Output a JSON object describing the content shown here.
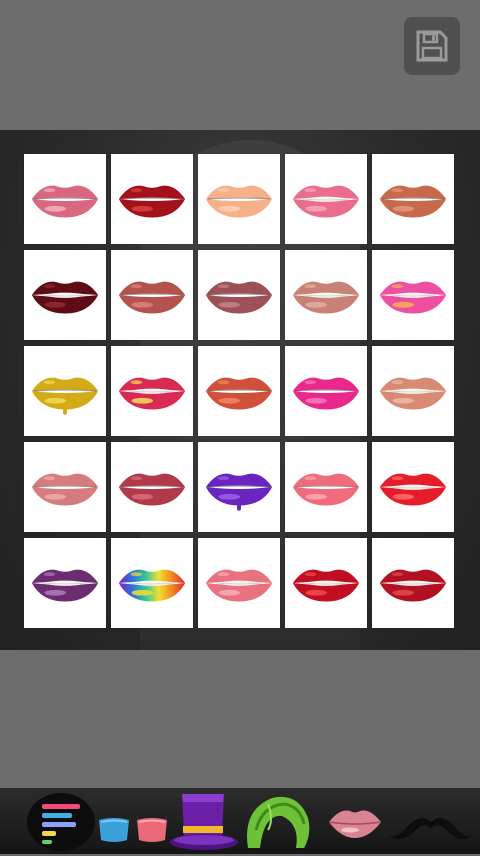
{
  "toolbar": {
    "save_icon": "floppy-disk-icon",
    "tools": [
      "menu-bars-icon",
      "blue-blush-icon",
      "pink-blush-icon",
      "purple-top-hat-icon",
      "green-hair-wig-icon",
      "lips-icon",
      "mustache-icon"
    ]
  },
  "lips_grid": {
    "columns": 5,
    "rows": 5,
    "items": [
      {
        "color": "#d9677f",
        "highlight": "#f3b3c2",
        "style": "closed"
      },
      {
        "color": "#a3111b",
        "highlight": "#d8433f",
        "style": "closed"
      },
      {
        "color": "#f7b189",
        "highlight": "#fcd1b5",
        "style": "closed"
      },
      {
        "color": "#eb6d8c",
        "highlight": "#f6a9bb",
        "style": "open"
      },
      {
        "color": "#c8694c",
        "highlight": "#e39a7f",
        "style": "closed"
      },
      {
        "color": "#5e0b16",
        "highlight": "#8f2a32",
        "style": "open"
      },
      {
        "color": "#b4524e",
        "highlight": "#d9857f",
        "style": "closed"
      },
      {
        "color": "#9c5157",
        "highlight": "#c4838a",
        "style": "closed"
      },
      {
        "color": "#c88275",
        "highlight": "#e2b0a4",
        "style": "open"
      },
      {
        "color": "#ee4fa1",
        "highlight": "#f8b255",
        "style": "open"
      },
      {
        "color": "#d3aa18",
        "highlight": "#f4d850",
        "style": "drip"
      },
      {
        "color": "#d82a55",
        "highlight": "#f2e35a",
        "style": "open"
      },
      {
        "color": "#d1503a",
        "highlight": "#f08a61",
        "style": "closed"
      },
      {
        "color": "#e9278c",
        "highlight": "#f77bbd",
        "style": "closed"
      },
      {
        "color": "#d88a74",
        "highlight": "#efb9a8",
        "style": "open"
      },
      {
        "color": "#d77c7e",
        "highlight": "#efadab",
        "style": "closed"
      },
      {
        "color": "#b2394a",
        "highlight": "#d6707c",
        "style": "closed"
      },
      {
        "color": "#6a25c0",
        "highlight": "#9a63e6",
        "style": "drip"
      },
      {
        "color": "#f06c7c",
        "highlight": "#fbaab4",
        "style": "closed"
      },
      {
        "color": "#e51d2a",
        "highlight": "#ff6c6c",
        "style": "open"
      },
      {
        "color": "#6a2e70",
        "highlight": "#b07bb7",
        "style": "open"
      },
      {
        "color": "#2ea6e0",
        "highlight": "#f6de2f",
        "style": "rainbow"
      },
      {
        "color": "#e8727f",
        "highlight": "#f6aeb8",
        "style": "open"
      },
      {
        "color": "#c20e23",
        "highlight": "#ee4b52",
        "style": "open"
      },
      {
        "color": "#b11122",
        "highlight": "#e24b4c",
        "style": "open"
      }
    ]
  }
}
